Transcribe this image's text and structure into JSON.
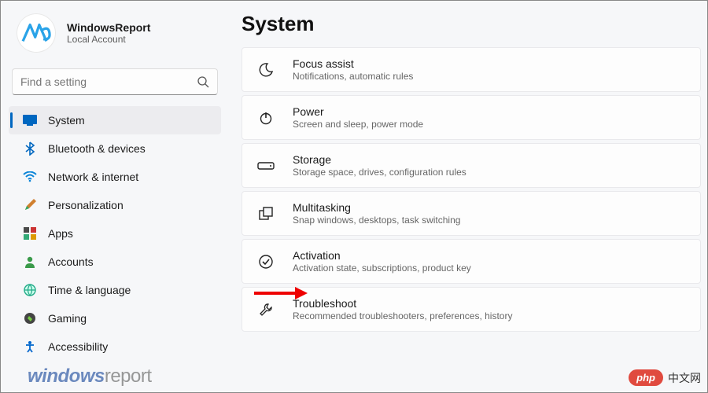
{
  "profile": {
    "name": "WindowsReport",
    "sub": "Local Account"
  },
  "search": {
    "placeholder": "Find a setting"
  },
  "page": {
    "title": "System"
  },
  "nav": [
    {
      "label": "System"
    },
    {
      "label": "Bluetooth & devices"
    },
    {
      "label": "Network & internet"
    },
    {
      "label": "Personalization"
    },
    {
      "label": "Apps"
    },
    {
      "label": "Accounts"
    },
    {
      "label": "Time & language"
    },
    {
      "label": "Gaming"
    },
    {
      "label": "Accessibility"
    }
  ],
  "cards": [
    {
      "title": "Focus assist",
      "sub": "Notifications, automatic rules"
    },
    {
      "title": "Power",
      "sub": "Screen and sleep, power mode"
    },
    {
      "title": "Storage",
      "sub": "Storage space, drives, configuration rules"
    },
    {
      "title": "Multitasking",
      "sub": "Snap windows, desktops, task switching"
    },
    {
      "title": "Activation",
      "sub": "Activation state, subscriptions, product key"
    },
    {
      "title": "Troubleshoot",
      "sub": "Recommended troubleshooters, preferences, history"
    }
  ],
  "watermarks": {
    "wr": "windows",
    "wr2": "report",
    "php": "php",
    "cn": "中文网"
  }
}
